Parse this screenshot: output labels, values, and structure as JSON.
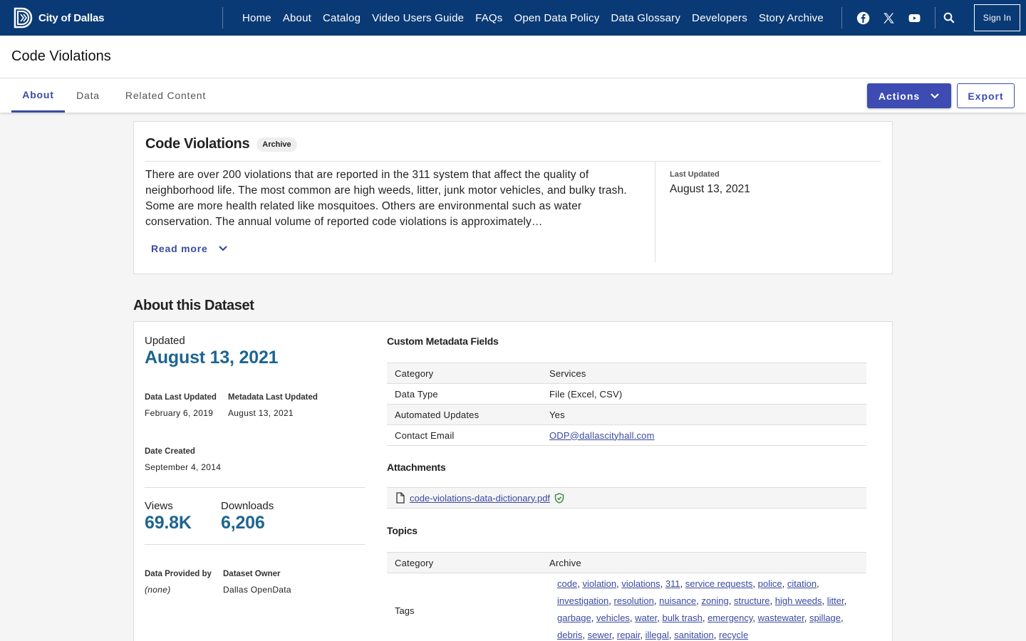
{
  "header": {
    "logo_text": "City of Dallas",
    "nav": [
      "Home",
      "About",
      "Catalog",
      "Video Users Guide",
      "FAQs",
      "Open Data Policy",
      "Data Glossary",
      "Developers",
      "Story Archive"
    ],
    "social_icons": [
      "facebook-icon",
      "x-twitter-icon",
      "youtube-icon"
    ],
    "sign_in": "Sign In",
    "color": "#0a3a75"
  },
  "page_title": "Code Violations",
  "tabs": [
    "About",
    "Data",
    "Related Content"
  ],
  "active_tab": "About",
  "actions_label": "Actions",
  "export_label": "Export",
  "summary": {
    "title": "Code Violations",
    "badge": "Archive",
    "description": "There are over 200 violations that are reported in the 311 system that affect the quality of neighborhood life. The most common are high weeds, litter, junk motor vehicles, and bulky trash. Some are more health related like mosquitoes. Others are environmental such as water conservation. The annual volume of reported code violations is approximately…",
    "read_more": "Read more",
    "last_updated_label": "Last Updated",
    "last_updated": "August 13, 2021"
  },
  "about": {
    "heading": "About this Dataset",
    "updated_label": "Updated",
    "updated": "August 13, 2021",
    "data_last_updated_label": "Data Last Updated",
    "data_last_updated": "February 6, 2019",
    "metadata_last_updated_label": "Metadata Last Updated",
    "metadata_last_updated": "August 13, 2021",
    "date_created_label": "Date Created",
    "date_created": "September 4, 2014",
    "views_label": "Views",
    "views": "69.8K",
    "downloads_label": "Downloads",
    "downloads": "6,206",
    "provided_by_label": "Data Provided by",
    "provided_by": "(none)",
    "owner_label": "Dataset Owner",
    "owner": "Dallas OpenData",
    "custom_metadata_title": "Custom Metadata Fields",
    "custom_metadata": [
      {
        "key": "Category",
        "value": "Services"
      },
      {
        "key": "Data Type",
        "value": "File (Excel, CSV)"
      },
      {
        "key": "Automated Updates",
        "value": "Yes"
      },
      {
        "key": "Contact Email",
        "value": "ODP@dallascityhall.com"
      }
    ],
    "attachments_title": "Attachments",
    "attachment": "code-violations-data-dictionary.pdf",
    "topics_title": "Topics",
    "topic_category_label": "Category",
    "topic_category": "Archive",
    "tags_label": "Tags",
    "tags": [
      "code",
      "violation",
      "violations",
      "311",
      "service requests",
      "police",
      "citation",
      "investigation",
      "resolution",
      "nuisance",
      "zoning",
      "structure",
      "high weeds",
      "litter",
      "garbage",
      "vehicles",
      "water",
      "bulk trash",
      "emergency",
      "wastewater",
      "spillage",
      "debris",
      "sewer",
      "repair",
      "illegal",
      "sanitation",
      "recycle"
    ]
  }
}
